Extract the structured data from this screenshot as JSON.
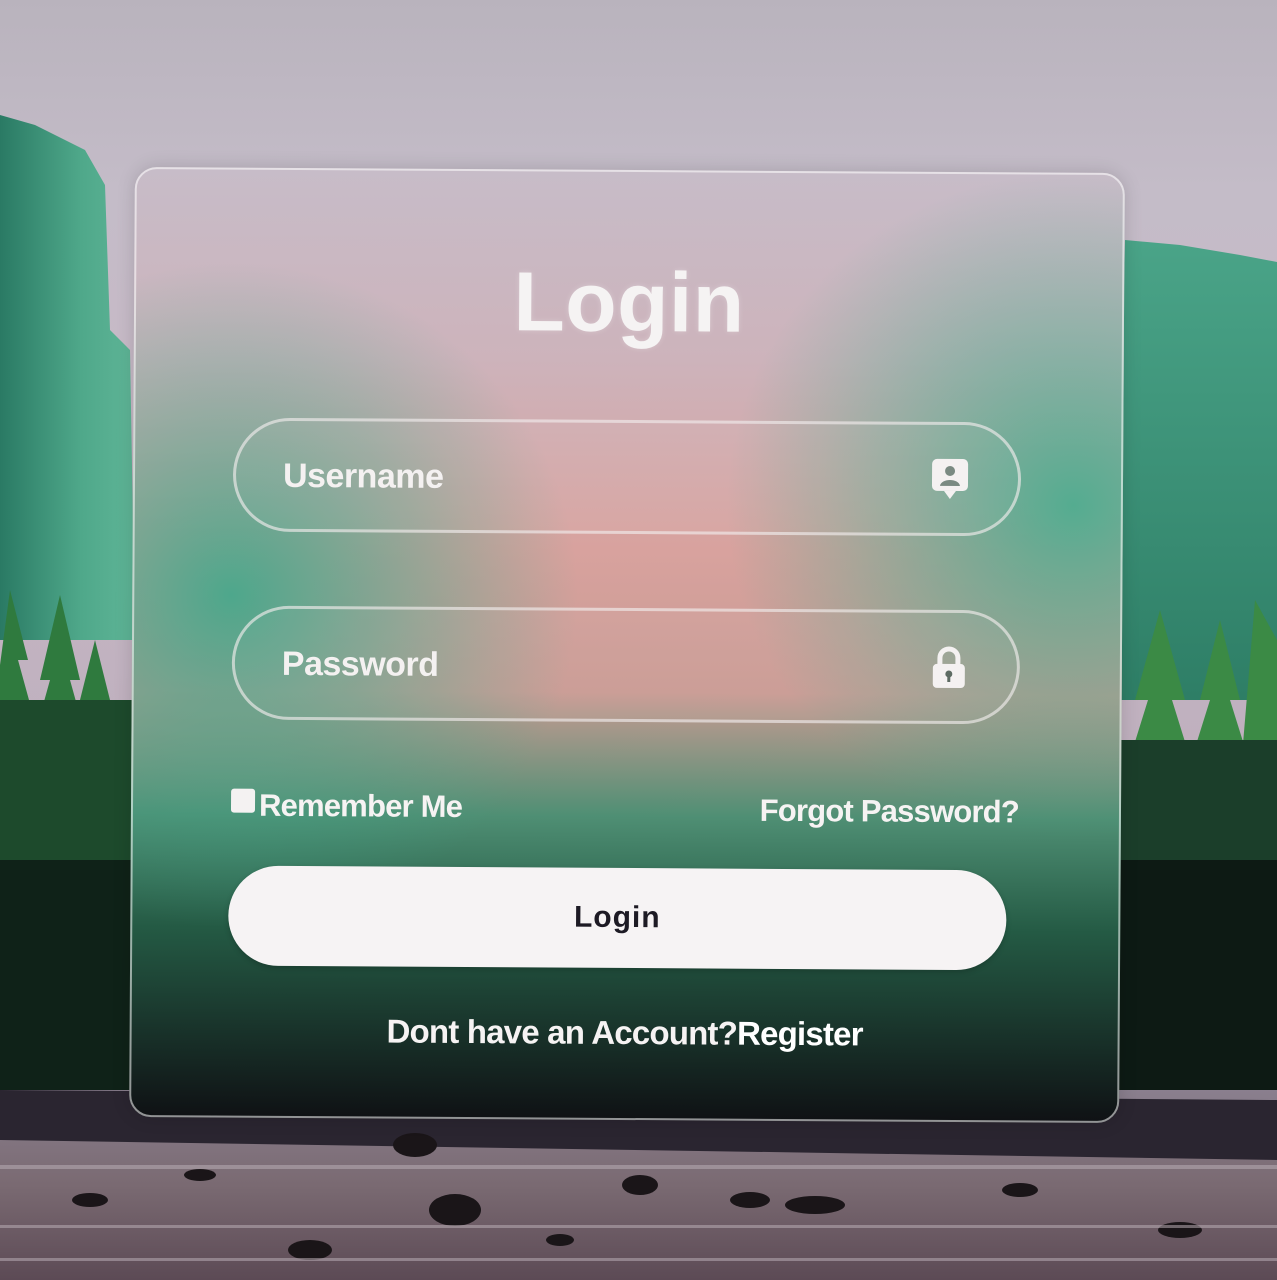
{
  "login_card": {
    "title": "Login",
    "username_field": {
      "placeholder": "Username",
      "value": "",
      "icon": "user-badge-icon"
    },
    "password_field": {
      "placeholder": "Password",
      "value": "",
      "icon": "lock-icon"
    },
    "remember_me": {
      "label": "Remember Me",
      "checked": false
    },
    "forgot_password_label": "Forgot Password?",
    "login_button_label": "Login",
    "register_prompt": "Dont have an Account?",
    "register_link_label": "Register"
  },
  "colors": {
    "text": "#f6f3f3",
    "button_bg": "#f6f3f4",
    "button_text": "#1d1a24"
  }
}
